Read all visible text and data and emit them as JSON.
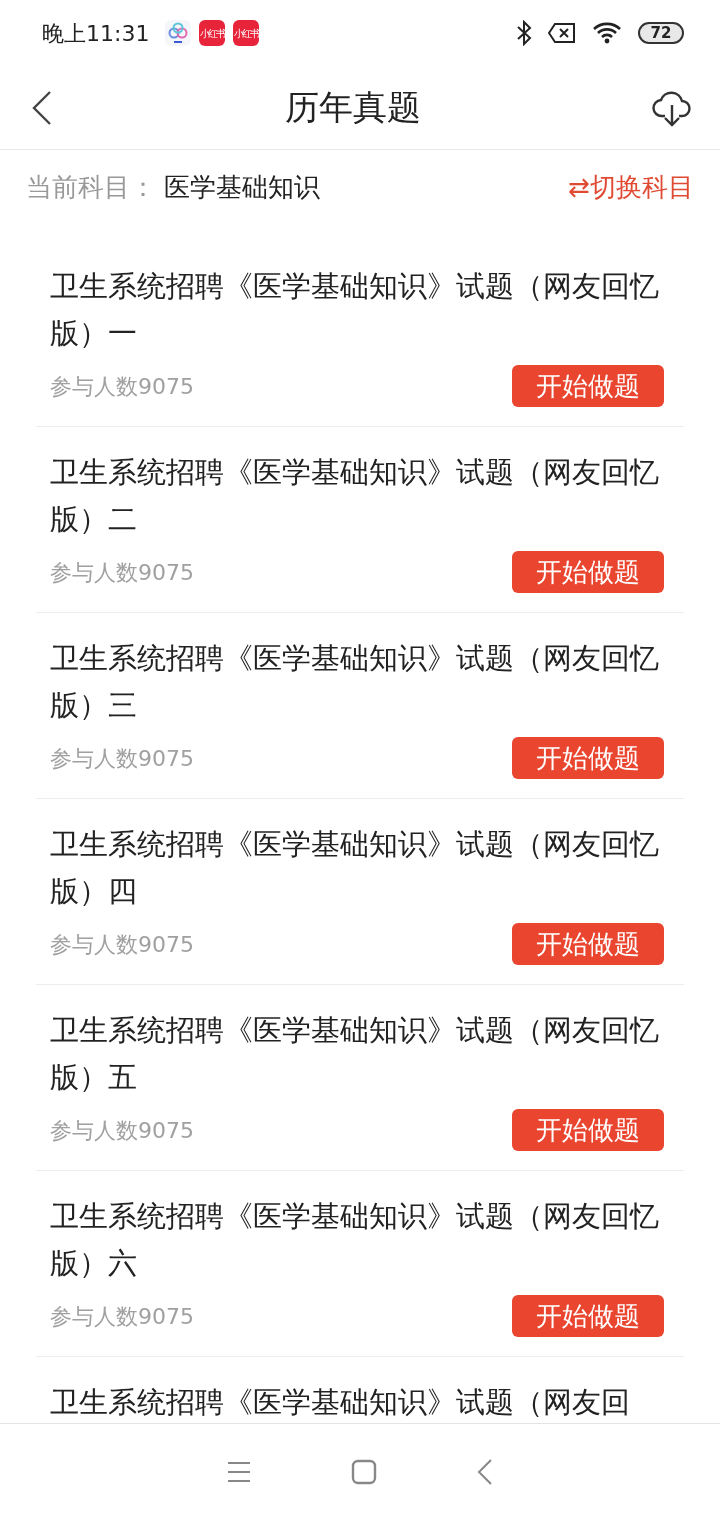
{
  "status_bar": {
    "time": "晚上11:31",
    "app_icons": [
      {
        "kind": "cloud"
      },
      {
        "kind": "label",
        "label": "小红书"
      },
      {
        "kind": "label",
        "label": "小红书"
      }
    ],
    "battery": "72"
  },
  "header": {
    "title": "历年真题"
  },
  "subject_bar": {
    "label": "当前科目：",
    "value": "医学基础知识",
    "switch_label": "⇄切换科目"
  },
  "papers": [
    {
      "title": "卫生系统招聘《医学基础知识》试题（网友回忆版）一",
      "participants": "参与人数9075",
      "action": "开始做题"
    },
    {
      "title": "卫生系统招聘《医学基础知识》试题（网友回忆版）二",
      "participants": "参与人数9075",
      "action": "开始做题"
    },
    {
      "title": "卫生系统招聘《医学基础知识》试题（网友回忆版）三",
      "participants": "参与人数9075",
      "action": "开始做题"
    },
    {
      "title": "卫生系统招聘《医学基础知识》试题（网友回忆版）四",
      "participants": "参与人数9075",
      "action": "开始做题"
    },
    {
      "title": "卫生系统招聘《医学基础知识》试题（网友回忆版）五",
      "participants": "参与人数9075",
      "action": "开始做题"
    },
    {
      "title": "卫生系统招聘《医学基础知识》试题（网友回忆版）六",
      "participants": "参与人数9075",
      "action": "开始做题"
    },
    {
      "title": "卫生系统招聘《医学基础知识》试题（网友回"
    }
  ]
}
